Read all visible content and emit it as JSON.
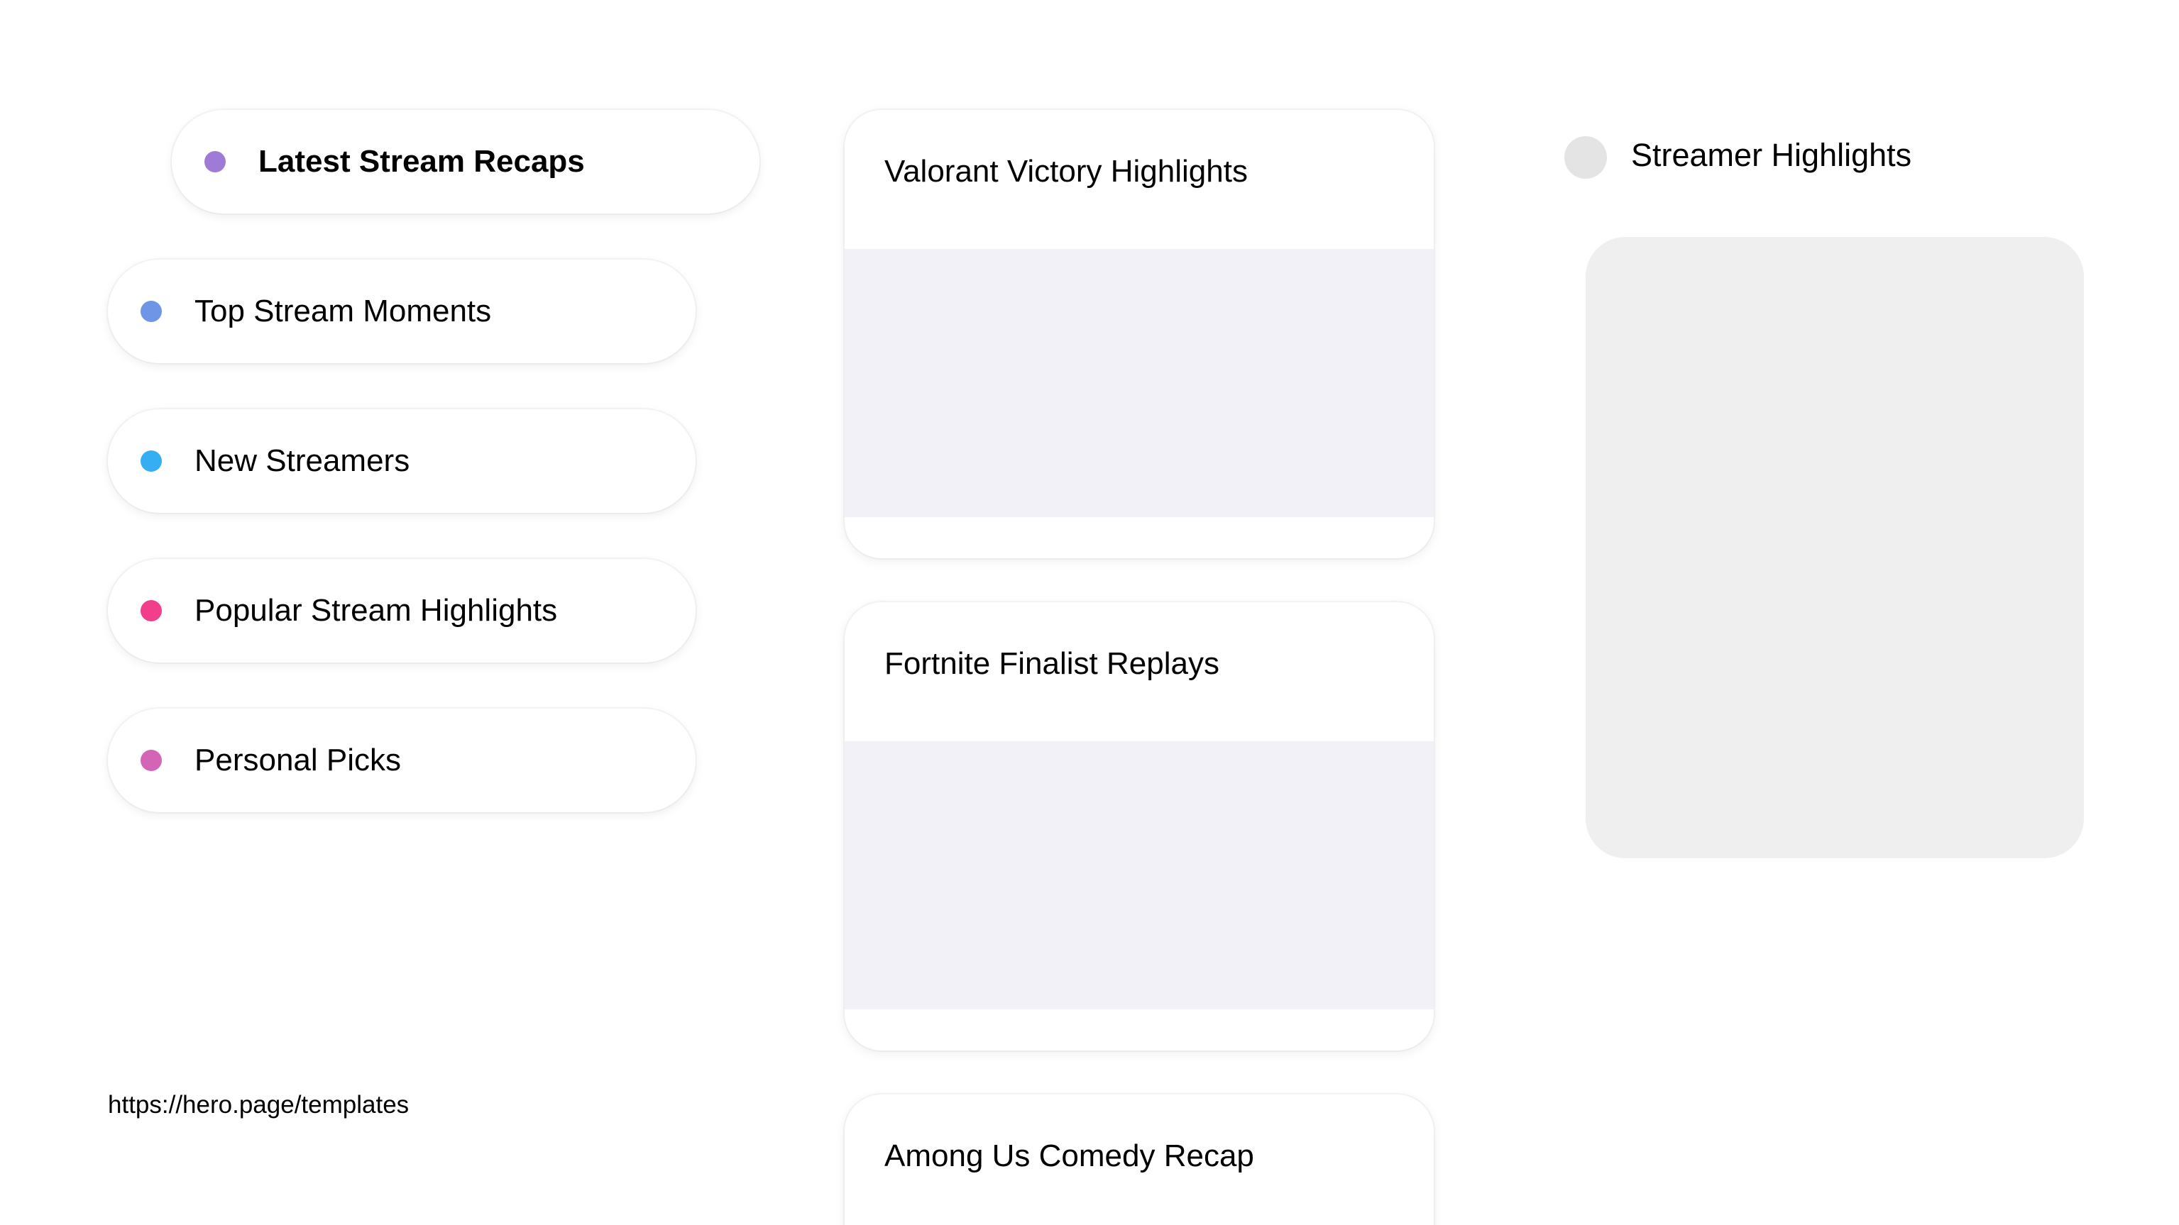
{
  "nav": {
    "items": [
      {
        "label": "Latest Stream Recaps",
        "dot_color": "#9f7ad6",
        "active": true
      },
      {
        "label": "Top Stream Moments",
        "dot_color": "#6f96e6",
        "active": false
      },
      {
        "label": "New Streamers",
        "dot_color": "#36aef4",
        "active": false
      },
      {
        "label": "Popular Stream Highlights",
        "dot_color": "#f23f8b",
        "active": false
      },
      {
        "label": "Personal Picks",
        "dot_color": "#d464b5",
        "active": false
      }
    ]
  },
  "footer": {
    "url": "https://hero.page/templates"
  },
  "cards": [
    {
      "title": "Valorant Victory Highlights"
    },
    {
      "title": "Fortnite Finalist Replays"
    },
    {
      "title": "Among Us Comedy Recap"
    }
  ],
  "side": {
    "title": "Streamer Highlights"
  },
  "colors": {
    "card_media": "#f3f1f8",
    "side_panel": "#efefef",
    "avatar": "#e4e4e4"
  }
}
